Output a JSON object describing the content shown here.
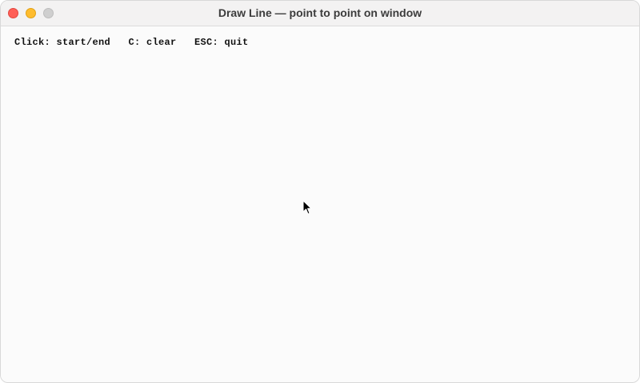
{
  "window": {
    "title": "Draw Line — point to point on window"
  },
  "canvas": {
    "instructions": "Click: start/end   C: clear   ESC: quit"
  },
  "icons": {
    "close": "close-button-icon",
    "minimize": "minimize-button-icon",
    "zoom": "zoom-button-icon",
    "pointer": "mouse-pointer-icon"
  },
  "colors": {
    "close": "#fe5f57",
    "minimize": "#febc2e",
    "zoom_inactive": "#cfcfcf",
    "canvas_background": "#fbfbfb",
    "text": "#111111"
  }
}
